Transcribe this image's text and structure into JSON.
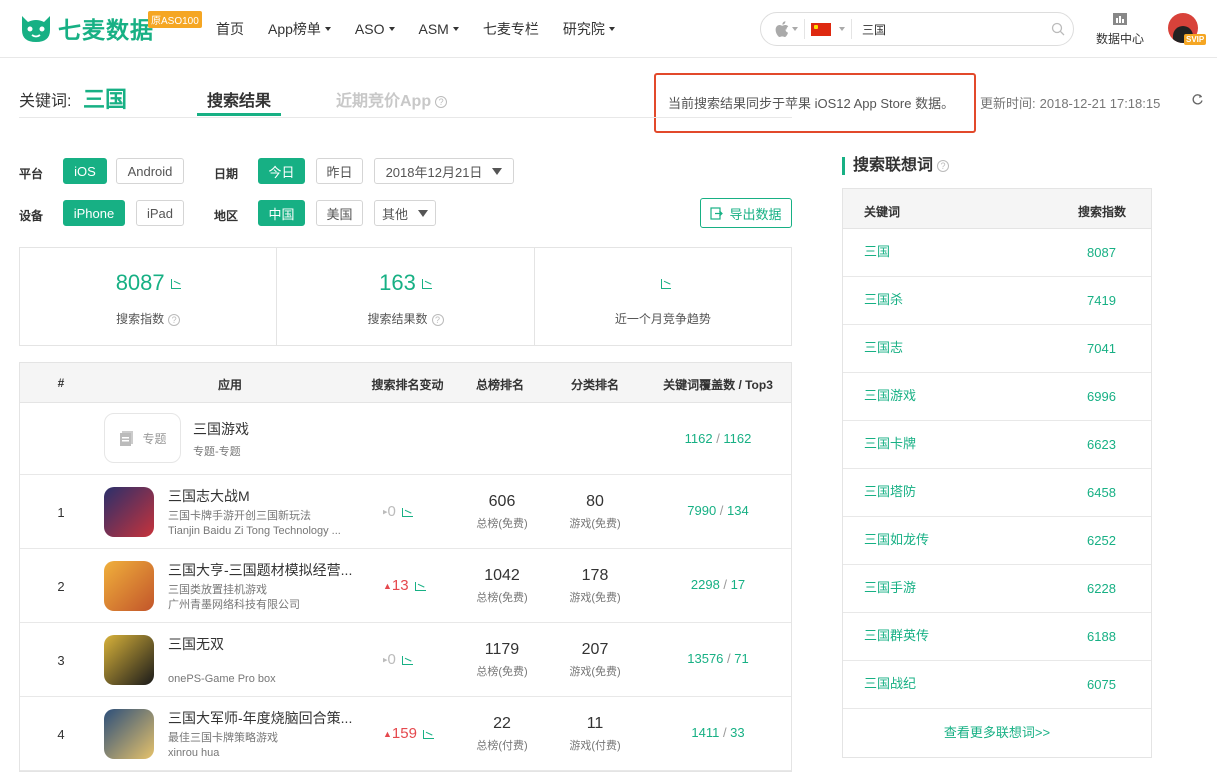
{
  "header": {
    "logo_text": "七麦数据",
    "logo_badge": "原ASO100",
    "nav": [
      "首页",
      "App榜单",
      "ASO",
      "ASM",
      "七麦专栏",
      "研究院"
    ],
    "nav_dropdown": [
      false,
      true,
      true,
      true,
      false,
      true
    ],
    "search_value": "三国",
    "data_center_label": "数据中心",
    "vip_badge": "SVIP"
  },
  "keyword": {
    "label": "关键词:",
    "value": "三国",
    "tab_active": "搜索结果",
    "tab_other": "近期竞价App",
    "notice": "当前搜索结果同步于苹果 iOS12 App Store 数据。",
    "update_label": "更新时间:",
    "update_time": "2018-12-21 17:18:15"
  },
  "filters": {
    "platform_label": "平台",
    "platform_options": [
      "iOS",
      "Android"
    ],
    "date_label": "日期",
    "date_options": [
      "今日",
      "昨日"
    ],
    "date_selected": "2018年12月21日",
    "device_label": "设备",
    "device_options": [
      "iPhone",
      "iPad"
    ],
    "region_label": "地区",
    "region_options": [
      "中国",
      "美国"
    ],
    "region_more": "其他",
    "export_label": "导出数据"
  },
  "stats": [
    {
      "value": "8087",
      "label": "搜索指数"
    },
    {
      "value": "163",
      "label": "搜索结果数"
    },
    {
      "value": "",
      "label": "近一个月竞争趋势"
    }
  ],
  "table": {
    "headers": [
      "#",
      "应用",
      "搜索排名变动",
      "总榜排名",
      "分类排名",
      "关键词覆盖数 / Top3"
    ],
    "topic_row": {
      "icon_label": "专题",
      "name": "三国游戏",
      "sub": "专题-专题",
      "cov_a": "1162",
      "cov_b": "1162"
    },
    "rows": [
      {
        "rank": "1",
        "name": "三国志大战M",
        "sub1": "三国卡牌手游开创三国新玩法",
        "sub2": "Tianjin Baidu Zi Tong Technology ...",
        "change": "0",
        "change_dir": "flat",
        "total_rank": "606",
        "total_label": "总榜(免费)",
        "cat_rank": "80",
        "cat_label": "游戏(免费)",
        "cov_a": "7990",
        "cov_b": "134"
      },
      {
        "rank": "2",
        "name": "三国大亨-三国题材模拟经营...",
        "sub1": "三国类放置挂机游戏",
        "sub2": "广州青墨网络科技有限公司",
        "change": "13",
        "change_dir": "up",
        "total_rank": "1042",
        "total_label": "总榜(免费)",
        "cat_rank": "178",
        "cat_label": "游戏(免费)",
        "cov_a": "2298",
        "cov_b": "17"
      },
      {
        "rank": "3",
        "name": "三国无双",
        "sub1": "",
        "sub2": "onePS-Game Pro box",
        "change": "0",
        "change_dir": "flat",
        "total_rank": "1179",
        "total_label": "总榜(免费)",
        "cat_rank": "207",
        "cat_label": "游戏(免费)",
        "cov_a": "13576",
        "cov_b": "71"
      },
      {
        "rank": "4",
        "name": "三国大军师-年度烧脑回合策...",
        "sub1": "最佳三国卡牌策略游戏",
        "sub2": "xinrou hua",
        "change": "159",
        "change_dir": "up",
        "total_rank": "22",
        "total_label": "总榜(付费)",
        "cat_rank": "11",
        "cat_label": "游戏(付费)",
        "cov_a": "1411",
        "cov_b": "33"
      }
    ]
  },
  "sidebar": {
    "title": "搜索联想词",
    "col_keyword": "关键词",
    "col_index": "搜索指数",
    "items": [
      {
        "k": "三国",
        "v": "8087"
      },
      {
        "k": "三国杀",
        "v": "7419"
      },
      {
        "k": "三国志",
        "v": "7041"
      },
      {
        "k": "三国游戏",
        "v": "6996"
      },
      {
        "k": "三国卡牌",
        "v": "6623"
      },
      {
        "k": "三国塔防",
        "v": "6458"
      },
      {
        "k": "三国如龙传",
        "v": "6252"
      },
      {
        "k": "三国手游",
        "v": "6228"
      },
      {
        "k": "三国群英传",
        "v": "6188"
      },
      {
        "k": "三国战纪",
        "v": "6075"
      }
    ],
    "more_label": "查看更多联想词>>"
  },
  "colors": {
    "accent": "#17b084",
    "notice_border": "#e2492b",
    "up": "#e5484d"
  }
}
